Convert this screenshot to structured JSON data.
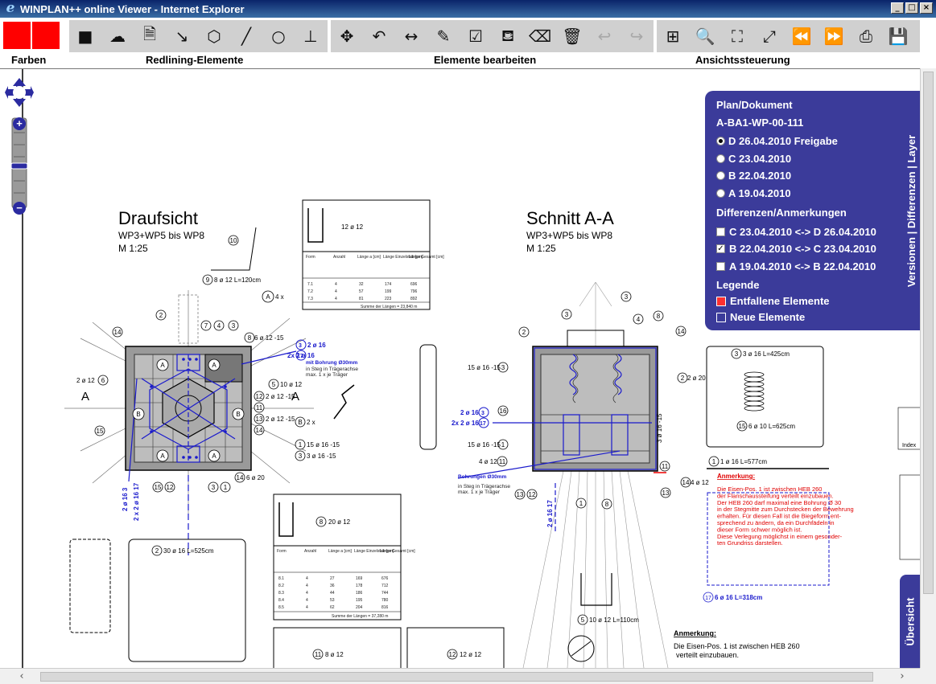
{
  "window": {
    "title": "WINPLAN++ online Viewer - Internet Explorer",
    "controls": [
      "_",
      "□",
      "×"
    ]
  },
  "toolbar": {
    "groups": [
      {
        "label": "Farben"
      },
      {
        "label": "Redlining-Elemente"
      },
      {
        "label": "Elemente bearbeiten"
      },
      {
        "label": "Ansichtssteuerung"
      }
    ],
    "colors": {
      "swatch": "#ff0000",
      "toolbar_bg": "#d0d0d0"
    }
  },
  "panel": {
    "heading_plan": "Plan/Dokument",
    "doc_id": "A-BA1-WP-00-111",
    "versions": [
      {
        "label": "D 26.04.2010 Freigabe",
        "selected": true
      },
      {
        "label": "C 23.04.2010",
        "selected": false
      },
      {
        "label": "B 22.04.2010",
        "selected": false
      },
      {
        "label": "A 19.04.2010",
        "selected": false
      }
    ],
    "heading_diff": "Differenzen/Anmerkungen",
    "diffs": [
      {
        "label": "C 23.04.2010 <-> D 26.04.2010",
        "checked": false
      },
      {
        "label": "B 22.04.2010 <-> C 23.04.2010",
        "checked": true
      },
      {
        "label": "A 19.04.2010 <-> B 22.04.2010",
        "checked": false
      }
    ],
    "heading_legend": "Legende",
    "legend": [
      {
        "label": "Entfallene Elemente",
        "color": "#ff3030"
      },
      {
        "label": "Neue Elemente",
        "color": "#3b3b9a"
      }
    ],
    "tab_label": "Versionen | Differenzen | Layer",
    "panel_color": "#3b3b9a"
  },
  "overview_tab": "Übersicht",
  "drawing": {
    "left_title": "Draufsicht",
    "left_sub": "WP3+WP5 bis WP8",
    "left_scale": "M 1:25",
    "right_title": "Schnitt A-A",
    "right_sub": "WP3+WP5 bis WP8",
    "right_scale": "M 1:25",
    "section_mark": "A",
    "bar_labels": {
      "l1": "8 ø 12  L=120cm",
      "l2": "12 ø 12",
      "l3": "20 ø 12",
      "l4": "30 ø 16  L=525cm",
      "l5": "3 ø 16  L=425cm",
      "l6": "6 ø 10  L=625cm",
      "l7": "1 ø 16  L=577cm",
      "l8": "10 ø 12  L=110cm",
      "l9": "6 ø 16  L=318cm",
      "l10": "8 ø 12",
      "l11": "12 ø 12",
      "l12": "15 ø 16 -15",
      "l13": "3 ø 16 -15",
      "l14": "6 ø 20",
      "l15": "2 ø 20",
      "l16": "4 ø 12",
      "l17": "2 x",
      "l18": "4 x",
      "l19": "6 ø 12 -15",
      "l20": "2 ø 12 -15",
      "l21": "2 ø 12 -15",
      "l22": "10 ø 12",
      "l23": "2 ø 12",
      "l24": "15 ø 16 -15",
      "l25": "4 ø 12"
    },
    "blue_labels": {
      "b1": "2 ø 16",
      "b2": "2x 2 ø 16",
      "b3": "mit Bohrung Ø30mm",
      "b4": "in Steg in Trägerachse",
      "b5": "max. 1 x je Träger",
      "b6": "2 ø 16",
      "b7": "2x 2 ø 16",
      "b8": "Bohrungen Ø30mm",
      "b9": "in Steg in Trägerachse",
      "b10": "max. 1 x je Träger"
    },
    "red_note": {
      "title": "Anmerkung:",
      "lines": [
        "Die Eisen-Pos. 1 ist zwischen HEB 260",
        "der Flanschaussteifung verteilt einzubauen.",
        "Der HEB 260 darf maximal eine Bohrung Ø 30",
        "in der Stegmitte zum Durchstecken der Bewehrung",
        "erhalten. Für diesen Fall ist die Biegeform ent-",
        "sprechend zu ändern, da ein Durchfädeln in",
        "dieser Form schwer möglich ist.",
        "Diese Verlegung möglichst in einem gesonder-",
        "ten Grundriss darstellen."
      ]
    },
    "black_note": {
      "title": "Anmerkung:",
      "lines": [
        "Die Eisen-Pos. 1 ist zwischen HEB 260",
        "verteilt einzubauen."
      ]
    },
    "table1": {
      "headers": [
        "Form",
        "Anzahl",
        "Länge a [cm]",
        "Länge Einzelstab [cm]",
        "Länge Gesamt [cm]"
      ],
      "rows": [
        [
          "7.1",
          "4",
          "32",
          "174",
          "696"
        ],
        [
          "7.2",
          "4",
          "57",
          "199",
          "796"
        ],
        [
          "7.3",
          "4",
          "81",
          "223",
          "892"
        ]
      ],
      "footer": "Summe der Längen = 23,840 m"
    },
    "table2": {
      "headers": [
        "Form",
        "Anzahl",
        "Länge a [cm]",
        "Länge Einzelstab [cm]",
        "Länge Gesamt [cm]"
      ],
      "rows": [
        [
          "8.1",
          "4",
          "27",
          "169",
          "676"
        ],
        [
          "8.2",
          "4",
          "36",
          "178",
          "712"
        ],
        [
          "8.3",
          "4",
          "44",
          "186",
          "744"
        ],
        [
          "8.4",
          "4",
          "53",
          "195",
          "780"
        ],
        [
          "8.5",
          "4",
          "62",
          "204",
          "816"
        ]
      ],
      "footer": "Summe der Längen = 37,280 m"
    },
    "index_label": "Index"
  }
}
